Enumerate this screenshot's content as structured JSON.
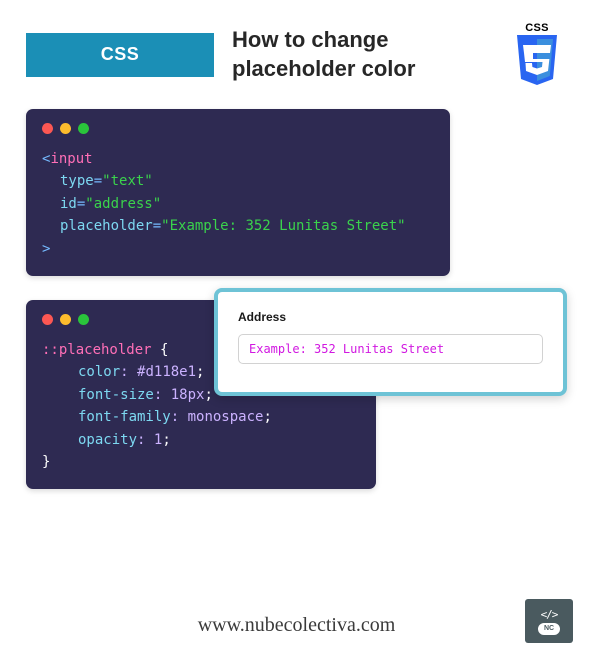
{
  "header": {
    "badge": "CSS",
    "title": "How to change placeholder color",
    "logo_text": "CSS"
  },
  "code1": {
    "tag_open": "input",
    "attrs": [
      {
        "name": "type",
        "value": "\"text\""
      },
      {
        "name": "id",
        "value": "\"address\""
      },
      {
        "name": "placeholder",
        "value": "\"Example: 352 Lunitas Street\""
      }
    ]
  },
  "code2": {
    "selector": "::placeholder",
    "props": [
      {
        "name": "color",
        "value": "#d118e1"
      },
      {
        "name": "font-size",
        "value": "18px"
      },
      {
        "name": "font-family",
        "value": "monospace"
      },
      {
        "name": "opacity",
        "value": "1"
      }
    ]
  },
  "preview": {
    "label": "Address",
    "placeholder": "Example: 352 Lunitas Street"
  },
  "footer": {
    "url": "www.nubecolectiva.com",
    "logo_label": "NC"
  }
}
